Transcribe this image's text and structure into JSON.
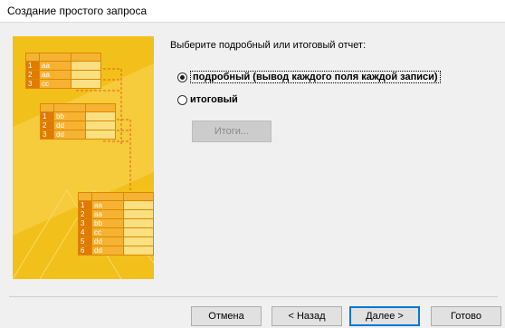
{
  "window": {
    "title": "Создание простого запроса"
  },
  "content": {
    "prompt": "Выберите подробный или итоговый отчет:",
    "options": [
      {
        "label": "подробный (вывод каждого поля каждой записи)",
        "selected": true
      },
      {
        "label": "итоговый",
        "selected": false
      }
    ],
    "totals_button": "Итоги...",
    "illustration": {
      "top_table": [
        [
          "1",
          "aa"
        ],
        [
          "2",
          "aa"
        ],
        [
          "3",
          "cc"
        ]
      ],
      "mid_table": [
        [
          "1",
          "bb"
        ],
        [
          "2",
          "dd"
        ],
        [
          "3",
          "dd"
        ]
      ],
      "bottom_table": [
        [
          "1",
          "aa"
        ],
        [
          "2",
          "aa"
        ],
        [
          "3",
          "bb"
        ],
        [
          "4",
          "cc"
        ],
        [
          "5",
          "dd"
        ],
        [
          "6",
          "dd"
        ]
      ]
    }
  },
  "footer": {
    "cancel": "Отмена",
    "back": "< Назад",
    "next": "Далее >",
    "finish": "Готово"
  }
}
